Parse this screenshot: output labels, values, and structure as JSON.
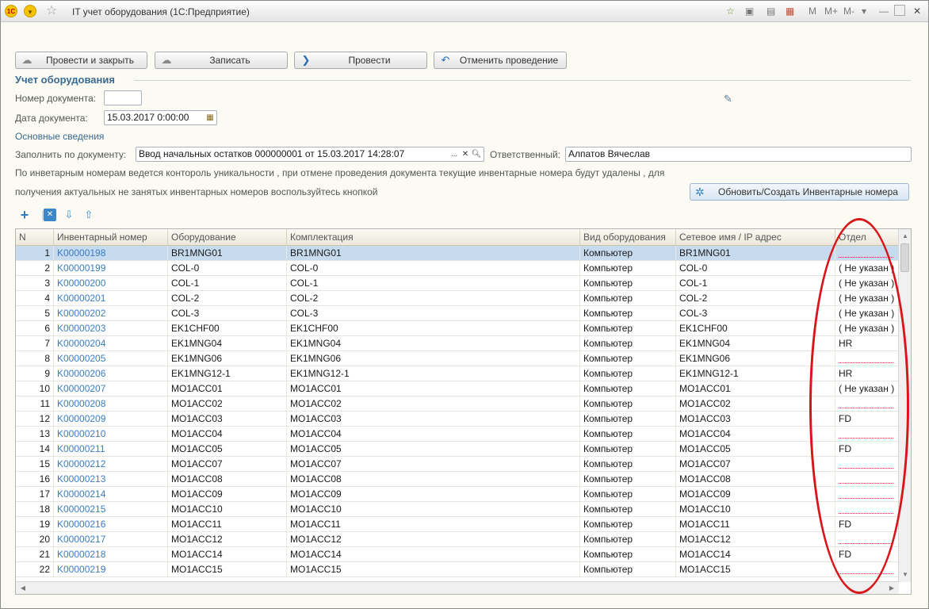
{
  "window": {
    "title": "IT учет оборудования  (1С:Предприятие)",
    "toolbar_right": [
      "M",
      "M+",
      "M-"
    ]
  },
  "commands": {
    "post_close": "Провести и закрыть",
    "save": "Записать",
    "post": "Провести",
    "cancel_post": "Отменить проведение"
  },
  "form": {
    "title": "Учет оборудования",
    "doc_number_label": "Номер документа:",
    "doc_number_value": "",
    "doc_date_label": "Дата документа:",
    "doc_date_value": "15.03.2017  0:00:00",
    "basic_info": "Основные сведения",
    "fill_by_label": "Заполнить по документу:",
    "fill_by_value": "Ввод начальных остатков 000000001 от 15.03.2017 14:28:07",
    "responsible_label": "Ответственный:",
    "responsible_value": "Алпатов Вячеслав",
    "note_line1": "По инветарным номерам ведется контороль уникальности , при отмене проведения документа текущие инвентарные номера будут удалены , для",
    "note_line2": "получения актуальных не занятых инвентарных номеров воспользуйтесь кнопкой",
    "refresh_button": "Обновить/Создать Инвентарные номера"
  },
  "table": {
    "columns": [
      "N",
      "Инвентарный номер",
      "Оборудование",
      "Комплектация",
      "Вид оборудования",
      "Сетевое имя / IP адрес",
      "Отдел"
    ],
    "rows": [
      [
        "1",
        "K00000198",
        "BR1MNG01",
        "BR1MNG01",
        "Компьютер",
        "BR1MNG01",
        ""
      ],
      [
        "2",
        "K00000199",
        "COL-0",
        "COL-0",
        "Компьютер",
        "COL-0",
        "( Не указан )"
      ],
      [
        "3",
        "K00000200",
        "COL-1",
        "COL-1",
        "Компьютер",
        "COL-1",
        "( Не указан )"
      ],
      [
        "4",
        "K00000201",
        "COL-2",
        "COL-2",
        "Компьютер",
        "COL-2",
        "( Не указан )"
      ],
      [
        "5",
        "K00000202",
        "COL-3",
        "COL-3",
        "Компьютер",
        "COL-3",
        "( Не указан )"
      ],
      [
        "6",
        "K00000203",
        "EK1CHF00",
        "EK1CHF00",
        "Компьютер",
        "EK1CHF00",
        "( Не указан )"
      ],
      [
        "7",
        "K00000204",
        "EK1MNG04",
        "EK1MNG04",
        "Компьютер",
        "EK1MNG04",
        "HR"
      ],
      [
        "8",
        "K00000205",
        "EK1MNG06",
        "EK1MNG06",
        "Компьютер",
        "EK1MNG06",
        ""
      ],
      [
        "9",
        "K00000206",
        "EK1MNG12-1",
        "EK1MNG12-1",
        "Компьютер",
        "EK1MNG12-1",
        "HR"
      ],
      [
        "10",
        "K00000207",
        "MO1ACC01",
        "MO1ACC01",
        "Компьютер",
        "MO1ACC01",
        "( Не указан )"
      ],
      [
        "11",
        "K00000208",
        "MO1ACC02",
        "MO1ACC02",
        "Компьютер",
        "MO1ACC02",
        ""
      ],
      [
        "12",
        "K00000209",
        "MO1ACC03",
        "MO1ACC03",
        "Компьютер",
        "MO1ACC03",
        "FD"
      ],
      [
        "13",
        "K00000210",
        "MO1ACC04",
        "MO1ACC04",
        "Компьютер",
        "MO1ACC04",
        ""
      ],
      [
        "14",
        "K00000211",
        "MO1ACC05",
        "MO1ACC05",
        "Компьютер",
        "MO1ACC05",
        "FD"
      ],
      [
        "15",
        "K00000212",
        "MO1ACC07",
        "MO1ACC07",
        "Компьютер",
        "MO1ACC07",
        ""
      ],
      [
        "16",
        "K00000213",
        "MO1ACC08",
        "MO1ACC08",
        "Компьютер",
        "MO1ACC08",
        ""
      ],
      [
        "17",
        "K00000214",
        "MO1ACC09",
        "MO1ACC09",
        "Компьютер",
        "MO1ACC09",
        ""
      ],
      [
        "18",
        "K00000215",
        "MO1ACC10",
        "MO1ACC10",
        "Компьютер",
        "MO1ACC10",
        ""
      ],
      [
        "19",
        "K00000216",
        "MO1ACC11",
        "MO1ACC11",
        "Компьютер",
        "MO1ACC11",
        "FD"
      ],
      [
        "20",
        "K00000217",
        "MO1ACC12",
        "MO1ACC12",
        "Компьютер",
        "MO1ACC12",
        ""
      ],
      [
        "21",
        "K00000218",
        "MO1ACC14",
        "MO1ACC14",
        "Компьютер",
        "MO1ACC14",
        "FD"
      ],
      [
        "22",
        "K00000219",
        "MO1ACC15",
        "MO1ACC15",
        "Компьютер",
        "MO1ACC15",
        ""
      ]
    ],
    "selected_row": 0
  },
  "colors": {
    "accent_text": "#3a6a91",
    "link": "#3b7cc4",
    "selection": "#c7dbef",
    "annotation": "#d8151b"
  }
}
